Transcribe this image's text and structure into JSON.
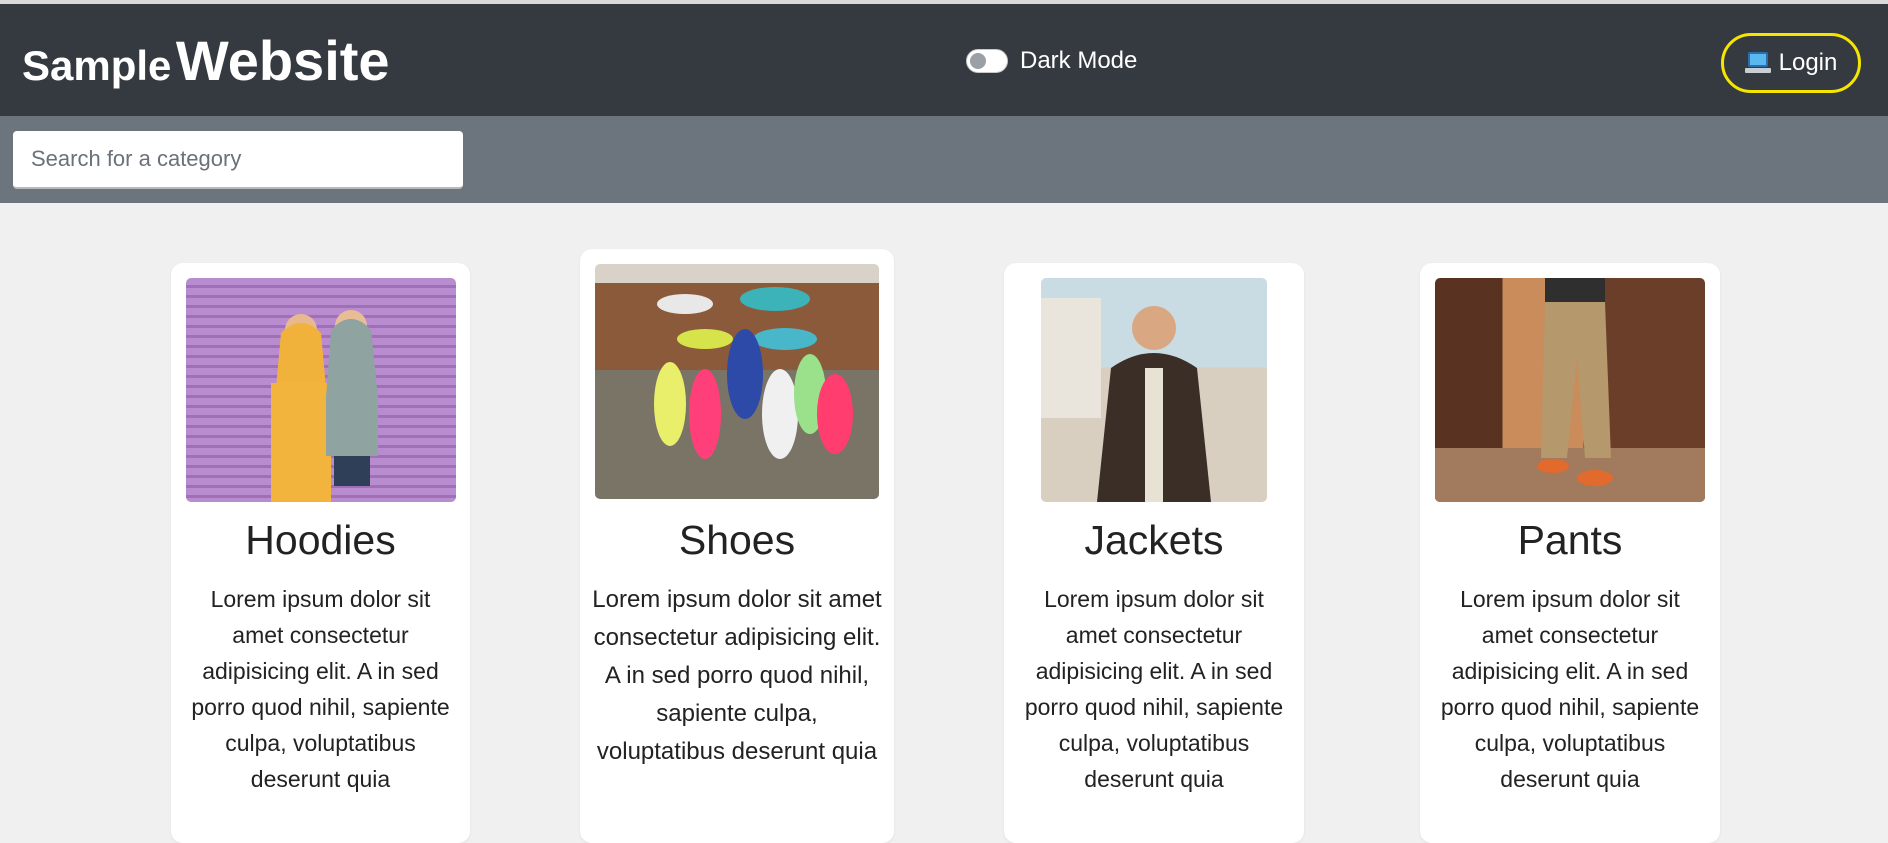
{
  "header": {
    "brand_small": "Sample",
    "brand_big": "Website",
    "dark_mode_label": "Dark Mode",
    "login_label": "Login"
  },
  "search": {
    "placeholder": "Search for a category"
  },
  "cards": [
    {
      "title": "Hoodies",
      "text": "Lorem ipsum dolor sit amet consectetur adipisicing elit. A in sed porro quod nihil, sapiente culpa, voluptatibus deserunt quia",
      "image": "hoodies-photo"
    },
    {
      "title": "Shoes",
      "text": "Lorem ipsum dolor sit amet consectetur adipisicing elit. A in sed porro quod nihil, sapiente culpa, voluptatibus deserunt quia",
      "image": "shoes-photo"
    },
    {
      "title": "Jackets",
      "text": "Lorem ipsum dolor sit amet consectetur adipisicing elit. A in sed porro quod nihil, sapiente culpa, voluptatibus deserunt quia",
      "image": "jackets-photo"
    },
    {
      "title": "Pants",
      "text": "Lorem ipsum dolor sit amet consectetur adipisicing elit. A in sed porro quod nihil, sapiente culpa, voluptatibus deserunt quia",
      "image": "pants-photo"
    }
  ],
  "colors": {
    "navbar": "#353a40",
    "search_band": "#6c747e",
    "login_border": "#f5e600",
    "page_background": "#f0f0f0"
  }
}
